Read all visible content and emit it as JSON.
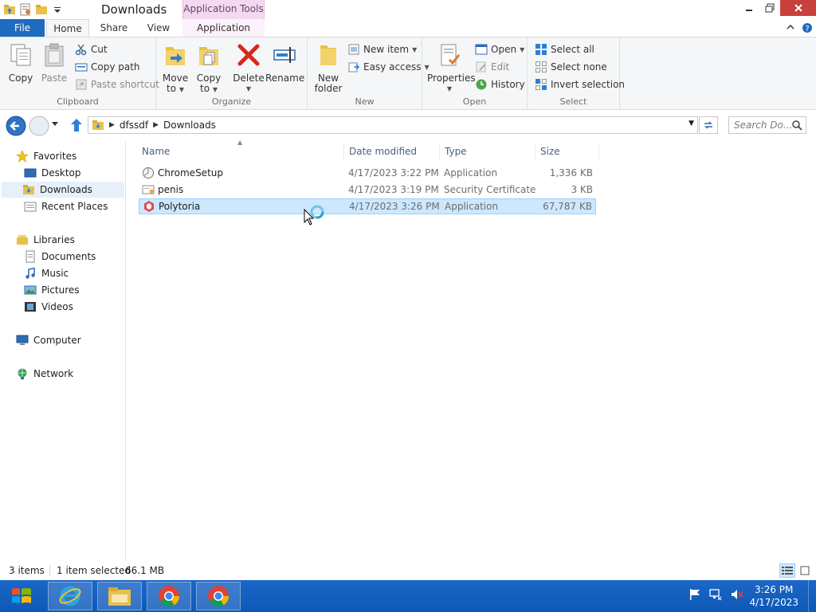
{
  "window": {
    "title": "Downloads",
    "context_tab": "Application Tools"
  },
  "tabs": {
    "file": "File",
    "home": "Home",
    "share": "Share",
    "view": "View",
    "application": "Application"
  },
  "ribbon": {
    "clipboard": {
      "label": "Clipboard",
      "copy": "Copy",
      "paste": "Paste",
      "cut": "Cut",
      "copy_path": "Copy path",
      "paste_shortcut": "Paste shortcut"
    },
    "organize": {
      "label": "Organize",
      "move_to_1": "Move",
      "move_to_2": "to",
      "copy_to_1": "Copy",
      "copy_to_2": "to",
      "delete": "Delete",
      "rename": "Rename"
    },
    "new": {
      "label": "New",
      "new_folder_1": "New",
      "new_folder_2": "folder",
      "new_item": "New item",
      "easy_access": "Easy access"
    },
    "open": {
      "label": "Open",
      "properties": "Properties",
      "open": "Open",
      "edit": "Edit",
      "history": "History"
    },
    "select": {
      "label": "Select",
      "select_all": "Select all",
      "select_none": "Select none",
      "invert_selection": "Invert selection"
    }
  },
  "address": {
    "crumbs": [
      "dfssdf",
      "Downloads"
    ],
    "search_placeholder": "Search Do..."
  },
  "navpane": {
    "favorites": "Favorites",
    "desktop": "Desktop",
    "downloads": "Downloads",
    "recent_places": "Recent Places",
    "libraries": "Libraries",
    "documents": "Documents",
    "music": "Music",
    "pictures": "Pictures",
    "videos": "Videos",
    "computer": "Computer",
    "network": "Network"
  },
  "columns": {
    "name": "Name",
    "date_modified": "Date modified",
    "type": "Type",
    "size": "Size"
  },
  "files": [
    {
      "name": "ChromeSetup",
      "date": "4/17/2023 3:22 PM",
      "type": "Application",
      "size": "1,336 KB"
    },
    {
      "name": "penis",
      "date": "4/17/2023 3:19 PM",
      "type": "Security Certificate",
      "size": "3 KB"
    },
    {
      "name": "Polytoria",
      "date": "4/17/2023 3:26 PM",
      "type": "Application",
      "size": "67,787 KB"
    }
  ],
  "status": {
    "items": "3 items",
    "selected": "1 item selected",
    "selected_size": "66.1 MB"
  },
  "clock": {
    "time": "3:26 PM",
    "date": "4/17/2023"
  },
  "colors": {
    "file_tab": "#1f6bbf",
    "selection": "#cce8ff",
    "taskbar": "#1b66c6",
    "close_button": "#c7403a"
  }
}
